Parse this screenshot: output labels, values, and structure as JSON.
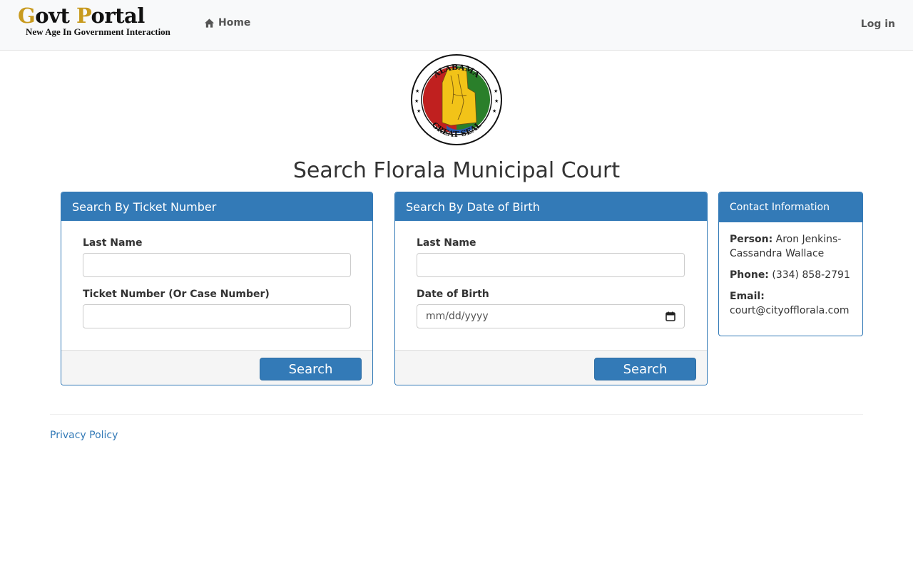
{
  "nav": {
    "brand_title_first": "G",
    "brand_title_mid": "ovt ",
    "brand_title_p": "P",
    "brand_title_rest": "ortal",
    "brand_subtitle": "New Age In Government Interaction",
    "home_label": "Home",
    "login_label": "Log in"
  },
  "seal": {
    "top_text": "ALABAMA",
    "bottom_text": "GREAT SEAL"
  },
  "page_title": "Search Florala Municipal Court",
  "ticket_panel": {
    "heading": "Search By Ticket Number",
    "last_name_label": "Last Name",
    "last_name_value": "",
    "ticket_label": "Ticket Number (Or Case Number)",
    "ticket_value": "",
    "search_button": "Search"
  },
  "dob_panel": {
    "heading": "Search By Date of Birth",
    "last_name_label": "Last Name",
    "last_name_value": "",
    "dob_label": "Date of Birth",
    "dob_placeholder": "mm/dd/yyyy",
    "search_button": "Search"
  },
  "contact_panel": {
    "heading": "Contact Information",
    "person_label": "Person:",
    "person_value": "Aron Jenkins-Cassandra Wallace",
    "phone_label": "Phone:",
    "phone_value": "(334) 858-2791",
    "email_label": "Email:",
    "email_value": "court@cityofflorala.com"
  },
  "footer": {
    "privacy_label": "Privacy Policy"
  },
  "colors": {
    "primary": "#337ab7",
    "brand_gold": "#c89a1e"
  }
}
